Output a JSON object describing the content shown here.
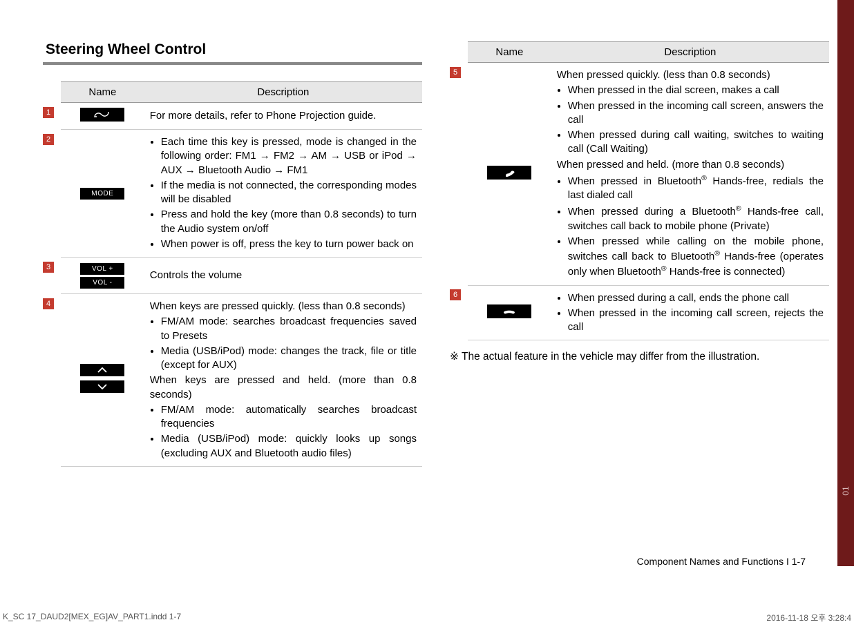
{
  "title": "Steering Wheel Control",
  "headers": {
    "name": "Name",
    "description": "Description"
  },
  "left_rows": [
    {
      "num": "1",
      "icon": "voice",
      "desc_plain": "For more details, refer to Phone Projection guide."
    },
    {
      "num": "2",
      "icon": "mode",
      "bullets": [
        "Each time this key is pressed, mode is changed in the following order: FM1 → FM2 → AM → USB or iPod → AUX → Bluetooth Audio → FM1",
        "If the media is not connected, the corresponding modes will be disabled",
        "Press and hold the key (more than 0.8 seconds) to turn the Audio system on/off",
        "When power is off, press the key to turn power back on"
      ]
    },
    {
      "num": "3",
      "icon": "vol",
      "desc_plain": "Controls the volume"
    },
    {
      "num": "4",
      "icon": "updown",
      "lead1": "When keys are pressed quickly. (less than 0.8 seconds)",
      "bullets1": [
        "FM/AM mode: searches broadcast frequencies saved to Presets",
        "Media (USB/iPod) mode: changes the track, file or title (except for AUX)"
      ],
      "lead2": "When keys are pressed and held. (more than 0.8 seconds)",
      "bullets2": [
        "FM/AM mode: automatically searches broadcast frequencies",
        "Media (USB/iPod) mode: quickly looks up songs (excluding AUX and Bluetooth audio files)"
      ]
    }
  ],
  "right_rows": [
    {
      "num": "5",
      "icon": "call",
      "lead1": "When pressed quickly. (less than 0.8 seconds)",
      "bullets1": [
        "When pressed in the dial screen, makes a call",
        "When pressed in the incoming call screen, answers the call",
        "When pressed during call waiting, switches to waiting call (Call Waiting)"
      ],
      "lead2": "When pressed and held. (more than 0.8 seconds)",
      "bullets2_html": [
        "When pressed in Bluetooth<sup>®</sup> Hands-free, redials the last dialed call",
        "When pressed during a Bluetooth<sup>®</sup> Hands-free call, switches call back to mobile phone (Private)",
        "When pressed while calling on the mobile phone, switches call back to Bluetooth<sup>®</sup> Hands-free (operates only when Bluetooth<sup>®</sup> Hands-free is connected)"
      ]
    },
    {
      "num": "6",
      "icon": "end",
      "bullets": [
        "When pressed during a call, ends the phone call",
        "When pressed in the incoming call screen, rejects the call"
      ]
    }
  ],
  "note": "※ The actual feature in the vehicle may differ from the illustration.",
  "footer_section": "Component Names and Functions I 1-7",
  "side_tab": "01",
  "print_left": "K_SC 17_DAUD2[MEX_EG]AV_PART1.indd   1-7",
  "print_right": "2016-11-18   오후 3:28:4",
  "icon_labels": {
    "mode": "MODE",
    "vol_plus": "VOL +",
    "vol_minus": "VOL -"
  }
}
